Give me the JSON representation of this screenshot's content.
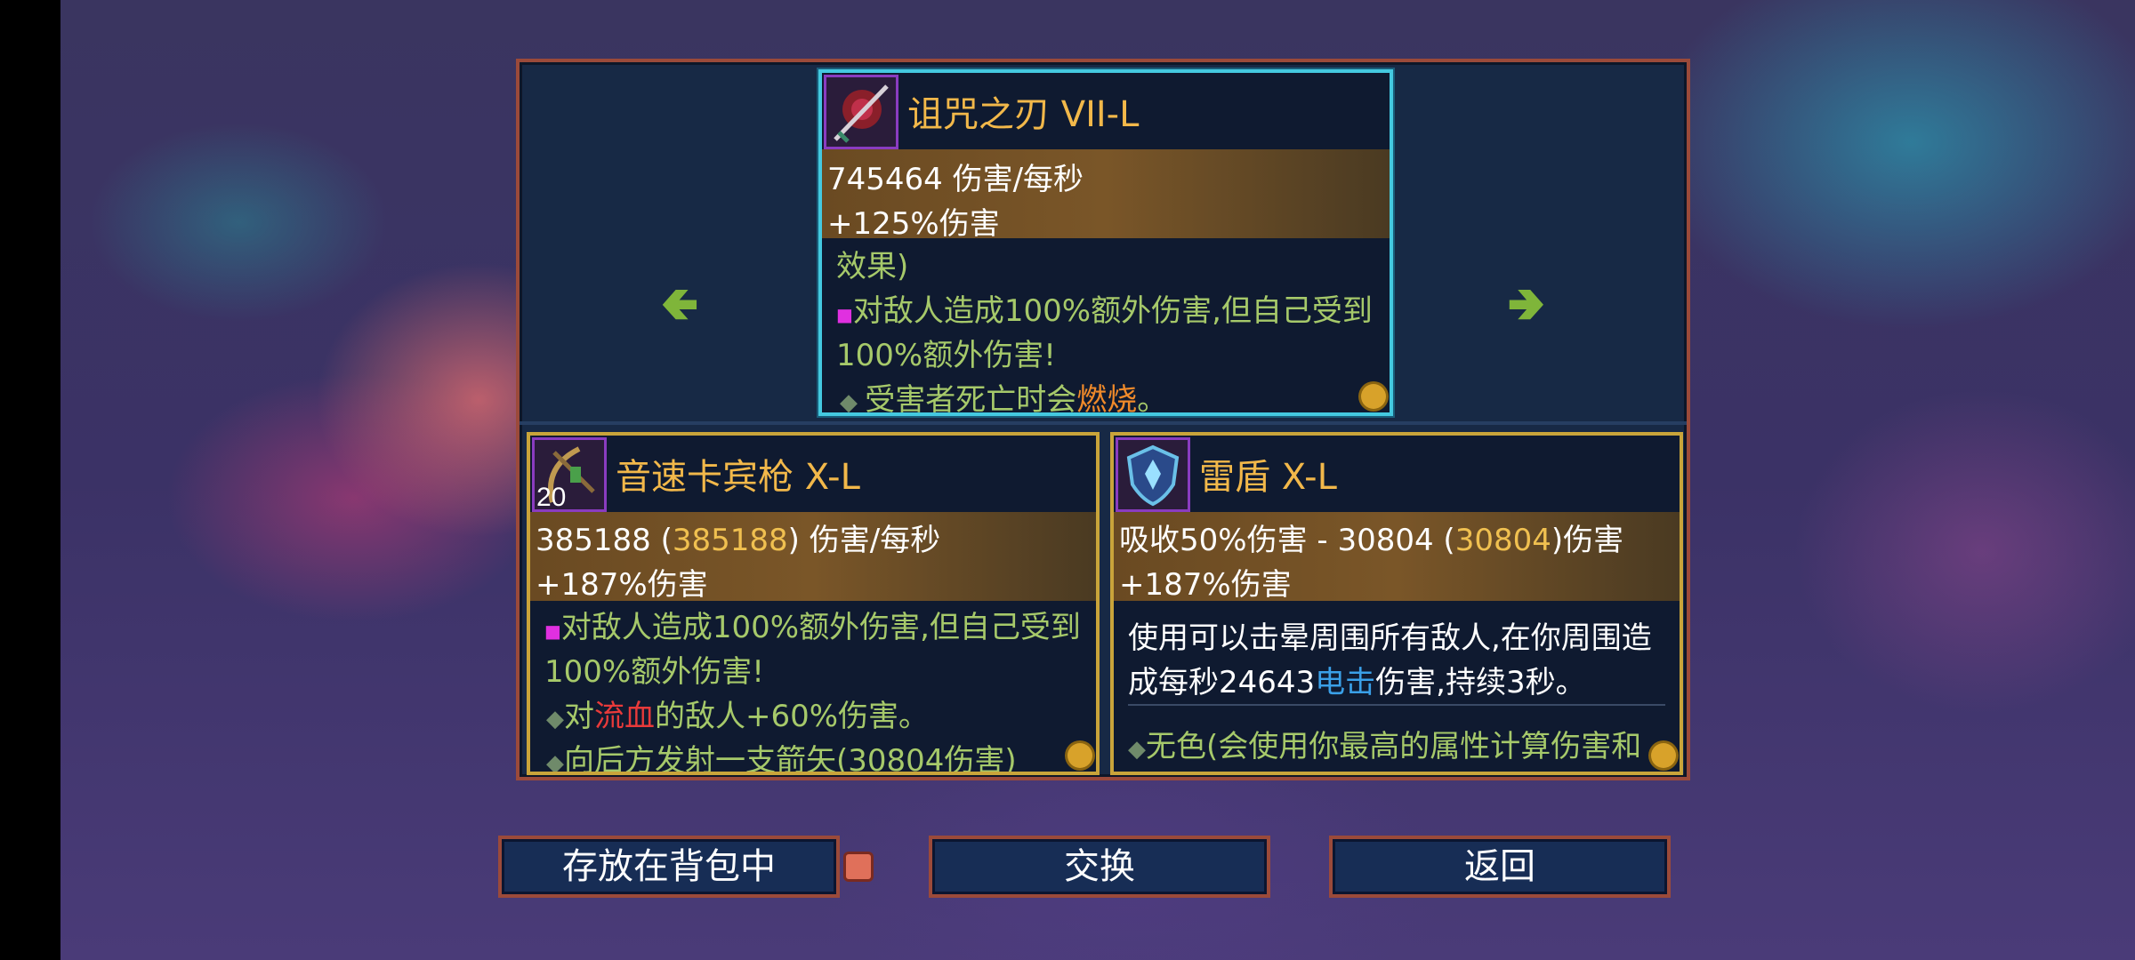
{
  "featured": {
    "name": "诅咒之刃",
    "tier": "VII-L",
    "dps": "745464 伤害/每秒",
    "bonus": "+125%伤害",
    "lines": {
      "effect_header": "效果)",
      "curse_1": "对敌人造成100%额外伤害,但自己受到",
      "curse_2": "100%额外伤害!",
      "burn_pre": "受害者死亡时会",
      "burn_word": "燃烧",
      "burn_post": "。"
    }
  },
  "left_item": {
    "name": "音速卡宾枪",
    "tier": "X-L",
    "level": "20",
    "dps_base": "385188 (",
    "dps_boosted": "385188",
    "dps_suffix": ") 伤害/每秒",
    "bonus": "+187%伤害",
    "lines": {
      "curse_1": "对敌人造成100%额外伤害,但自己受到",
      "curse_2": "100%额外伤害!",
      "bleed_pre": "对",
      "bleed_word": "流血",
      "bleed_post": "的敌人+60%伤害。",
      "arrow": "向后方发射一支箭矢(30804伤害)"
    }
  },
  "right_item": {
    "name": "雷盾",
    "tier": "X-L",
    "absorb_base": "吸收50%伤害 - 30804 (",
    "absorb_boosted": "30804",
    "absorb_suffix": ")伤害",
    "bonus": "+187%伤害",
    "lines": {
      "stun_1": "使用可以击晕周围所有敌人,在你周围造",
      "stun_2_pre": "成每秒24643",
      "stun_2_word": "电击",
      "stun_2_post": "伤害,持续3秒。",
      "colorless": "无色(会使用你最高的属性计算伤害和"
    }
  },
  "buttons": {
    "store": "存放在背包中",
    "swap": "交换",
    "back": "返回"
  },
  "colors": {
    "title": "#f2b84a",
    "effect": "#a6c96a",
    "frame_gold": "#c9a43a",
    "frame_cyan": "#44c9e0"
  }
}
